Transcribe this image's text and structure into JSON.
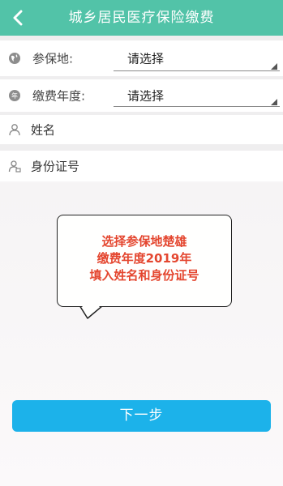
{
  "header": {
    "title": "城乡居民医疗保险缴费",
    "back_icon": "chevron-left-icon"
  },
  "form": {
    "insured_place": {
      "label": "参保地:",
      "value": "请选择",
      "icon": "globe-icon"
    },
    "payment_year": {
      "label": "缴费年度:",
      "value": "请选择",
      "icon": "calendar-icon"
    },
    "name": {
      "placeholder": "姓名",
      "icon": "person-icon"
    },
    "id_number": {
      "placeholder": "身份证号",
      "icon": "id-person-icon"
    }
  },
  "callout": {
    "line1": "选择参保地楚雄",
    "line2": "缴费年度2019年",
    "line3": "填入姓名和身份证号"
  },
  "next_button": {
    "label": "下一步"
  },
  "colors": {
    "header": "#52c3a8",
    "button": "#1cb2ea",
    "callout_text": "#e4462f"
  }
}
